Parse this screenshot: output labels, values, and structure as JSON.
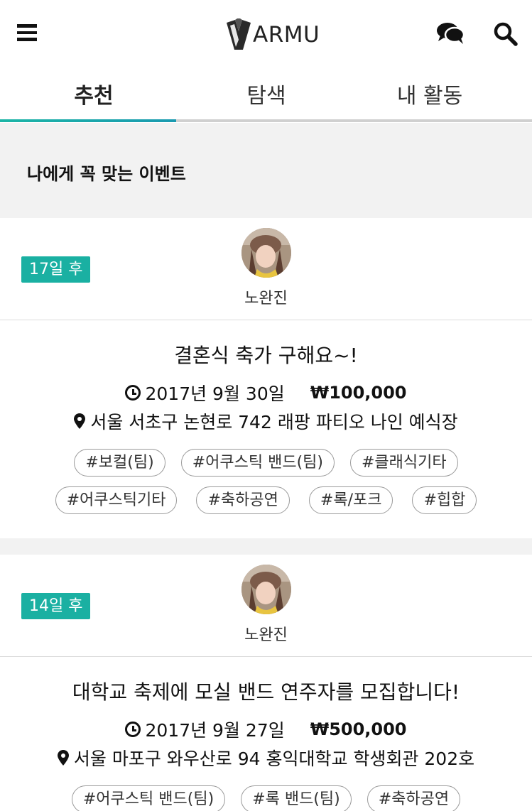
{
  "header": {
    "logo_text": "ARMU",
    "icons": [
      "menu-icon",
      "chat-icon",
      "search-icon"
    ]
  },
  "tabs": [
    {
      "label": "추천",
      "active": true
    },
    {
      "label": "탐색",
      "active": false
    },
    {
      "label": "내 활동",
      "active": false
    }
  ],
  "section": {
    "title": "나에게 꼭 맞는 이벤트"
  },
  "events": [
    {
      "dday": "17일 후",
      "host": "노완진",
      "title": "결혼식 축가 구해요~!",
      "date": "2017년 9월 30일",
      "price": "₩100,000",
      "address": "서울 서초구 논현로 742 래팡 파티오 나인 예식장",
      "tag_rows": [
        [
          "#보컬(팀)",
          "#어쿠스틱 밴드(팀)",
          "#클래식기타"
        ],
        [
          "#어쿠스틱기타",
          "#축하공연",
          "#록/포크",
          "#힙합"
        ]
      ]
    },
    {
      "dday": "14일 후",
      "host": "노완진",
      "title": "대학교 축제에 모실 밴드 연주자를 모집합니다!",
      "date": "2017년 9월 27일",
      "price": "₩500,000",
      "address": "서울 마포구 와우산로 94 홍익대학교 학생회관 202호",
      "tag_rows": [
        [
          "#어쿠스틱 밴드(팀)",
          "#록 밴드(팀)",
          "#축하공연"
        ]
      ]
    }
  ],
  "colors": {
    "accent": "#1ab0a2",
    "tab_bar": "#1cb5a6",
    "background": "#f2f2f2"
  }
}
